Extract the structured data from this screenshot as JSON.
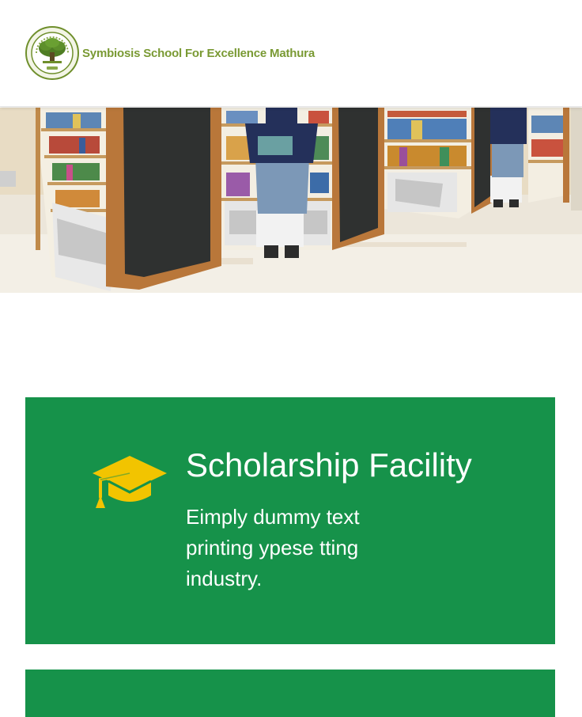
{
  "header": {
    "logo_text": "Symbiosis School For Excellence Mathura",
    "logo_icon": "tree-seal-icon",
    "brand_color": "#7a9a34"
  },
  "hero": {
    "image_subject": "library-photo"
  },
  "features": [
    {
      "icon": "graduation-cap-icon",
      "title": "Scholarship Facility",
      "text": "Eimply dummy text printing ypese tting industry."
    }
  ],
  "colors": {
    "card_background": "#16924a",
    "icon_color": "#f2c400",
    "text_color": "#ffffff"
  }
}
